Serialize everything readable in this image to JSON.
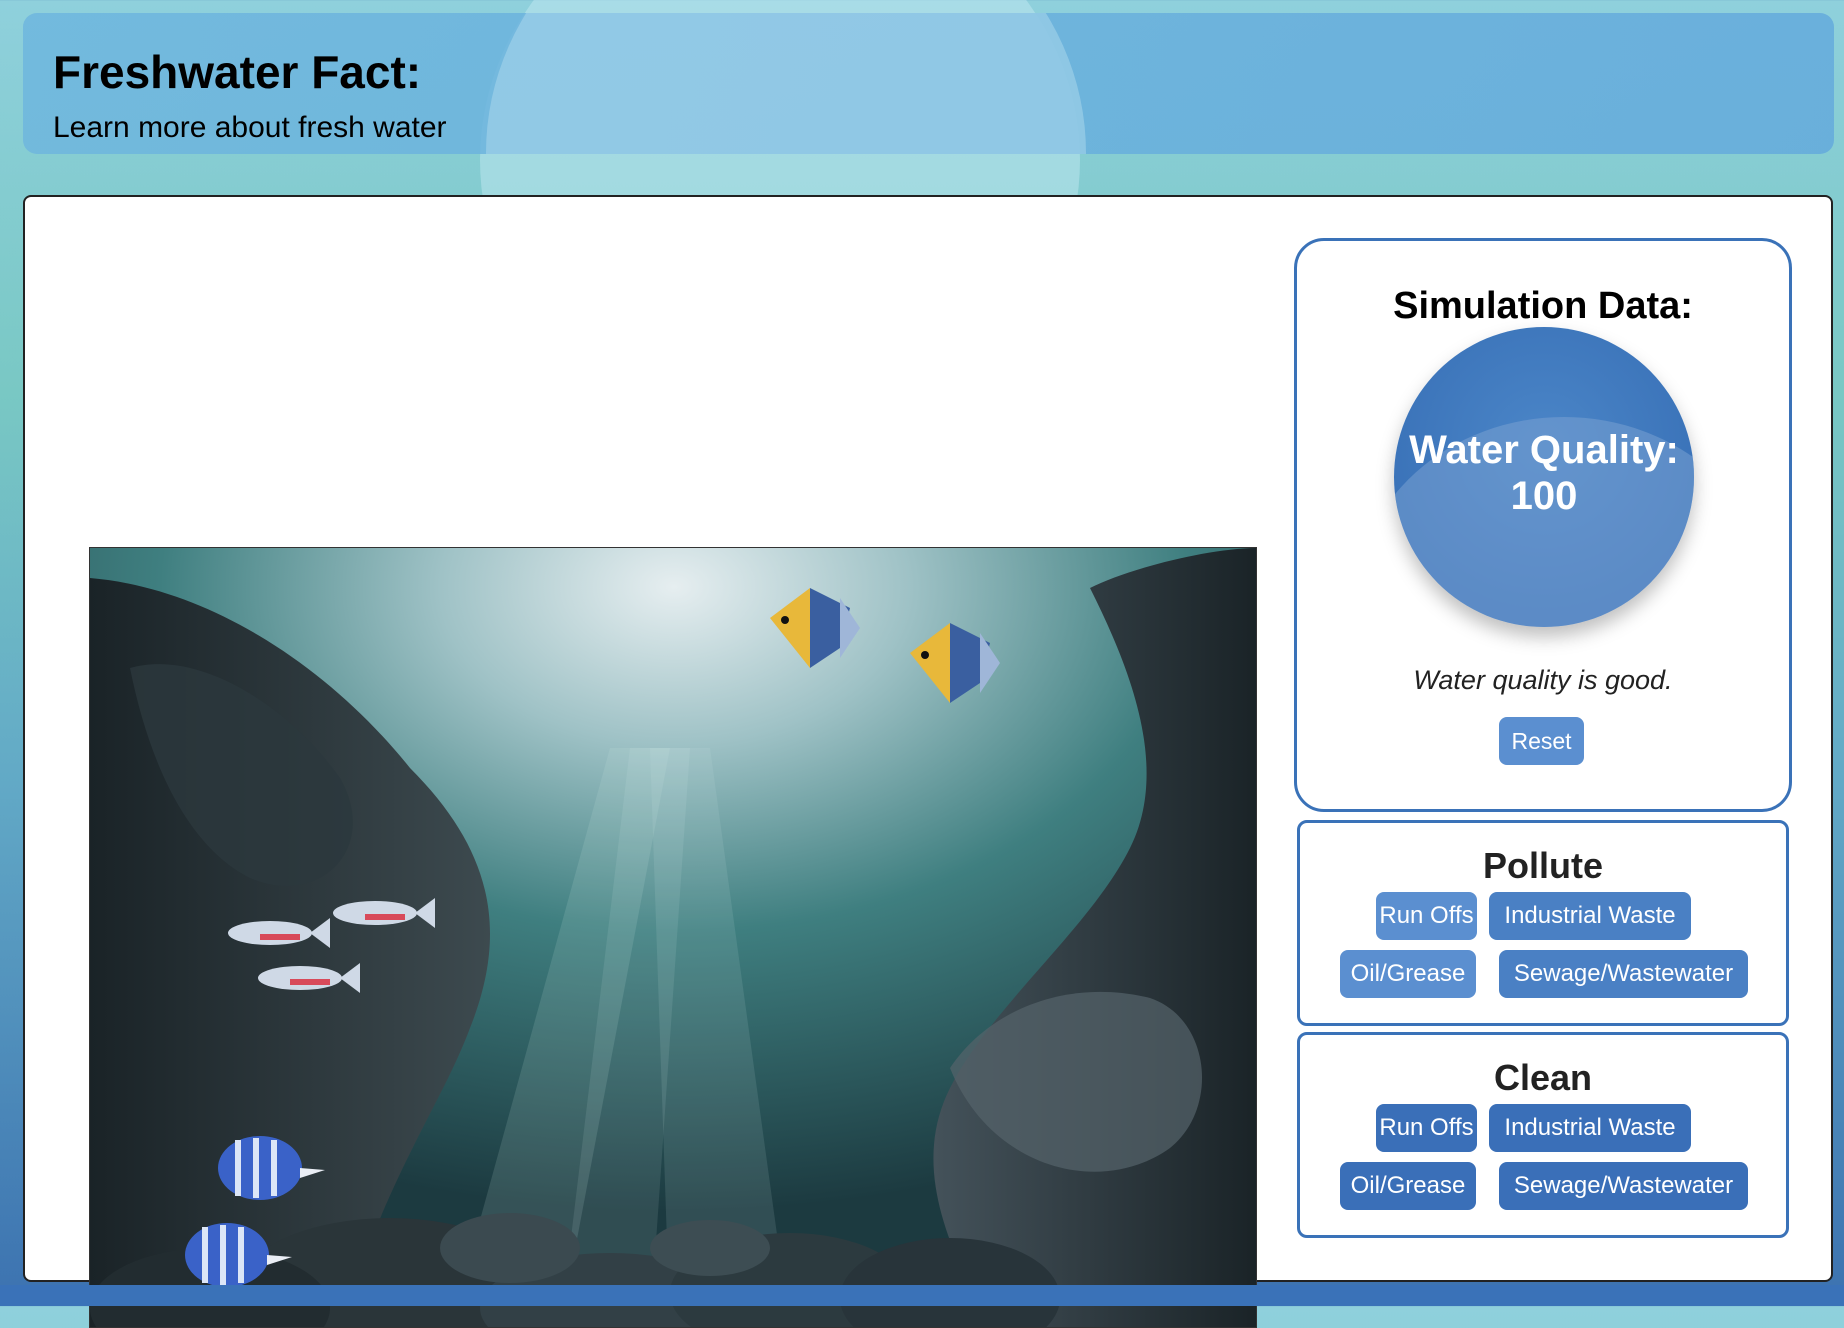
{
  "header": {
    "title": "Freshwater Fact:",
    "subtitle": "Learn more about fresh water"
  },
  "simulation": {
    "title": "Simulation Data:",
    "gauge_label": "Water Quality:",
    "gauge_value": "100",
    "status": "Water quality is good.",
    "reset_label": "Reset"
  },
  "pollute": {
    "title": "Pollute",
    "buttons": [
      "Run Offs",
      "Industrial Waste",
      "Oil/Grease",
      "Sewage/Wastewater"
    ]
  },
  "clean": {
    "title": "Clean",
    "buttons": [
      "Run Offs",
      "Industrial Waste",
      "Oil/Grease",
      "Sewage/Wastewater"
    ]
  },
  "colors": {
    "accent": "#3a72b8",
    "button_light": "#5b8fd0",
    "button_dark": "#3a6fb8"
  }
}
